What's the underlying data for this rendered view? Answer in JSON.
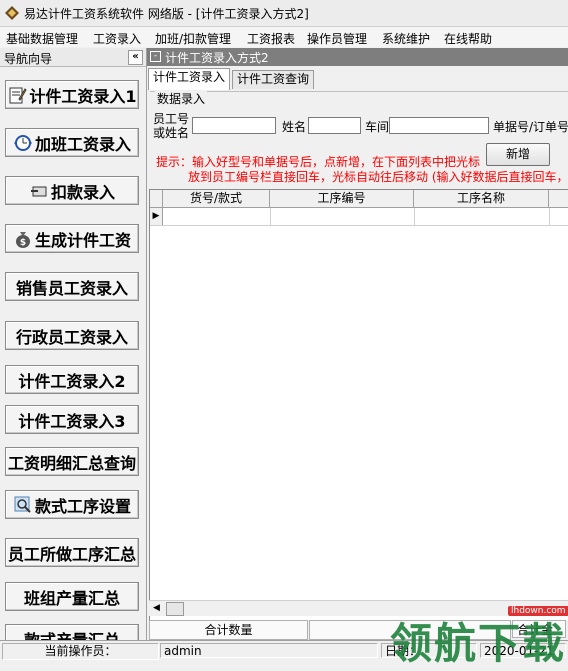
{
  "window": {
    "title": "易达计件工资系统软件  网络版  -  [计件工资录入方式2]"
  },
  "menu": [
    "基础数据管理",
    "工资录入",
    "加班/扣款管理",
    "工资报表",
    "操作员管理",
    "系统维护",
    "在线帮助"
  ],
  "nav": {
    "title": "导航向导",
    "collapse_label": "«",
    "items": [
      {
        "label": "计件工资录入1",
        "icon": "pencil-sheet-icon"
      },
      {
        "label": "加班工资录入",
        "icon": "clock-arrows-icon"
      },
      {
        "label": "扣款录入",
        "icon": "deduct-icon"
      },
      {
        "label": "生成计件工资",
        "icon": "money-bag-icon"
      },
      {
        "label": "销售员工资录入",
        "icon": ""
      },
      {
        "label": "行政员工资录入",
        "icon": ""
      },
      {
        "label": "计件工资录入2",
        "icon": ""
      },
      {
        "label": "计件工资录入3",
        "icon": ""
      },
      {
        "label": "工资明细汇总查询",
        "icon": ""
      },
      {
        "label": "款式工序设置",
        "icon": "search-magnifier-icon"
      },
      {
        "label": "员工所做工序汇总",
        "icon": ""
      },
      {
        "label": "班组产量汇总",
        "icon": ""
      },
      {
        "label": "款式产量汇总",
        "icon": ""
      }
    ]
  },
  "main": {
    "panel_title": "计件工资录入方式2",
    "close_glyph": "-",
    "tabs": [
      "计件工资录入",
      "计件工资查询"
    ],
    "group_title": "数据录入",
    "fields": {
      "emp_label_1": "员工号",
      "emp_label_2": "或姓名",
      "emp_value": "",
      "name_label": "姓名",
      "name_value": "",
      "workshop_label": "车间",
      "workshop_value": "",
      "order_label": "单据号/订单号",
      "order_value": ""
    },
    "add_button": "新增",
    "hint_line1": "提示：输入好型号和单据号后，点新增，在下面列表中把光标",
    "hint_line2": "放到员工编号栏直接回车，光标自动往后移动 (输入好数据后直接回车，光",
    "columns": [
      "货号/款式",
      "工序编号",
      "工序名称"
    ],
    "row_indicator": "▶",
    "footer_total_label": "合计数量",
    "footer_total_label_2": "合计金"
  },
  "status": {
    "operator_label": "当前操作员：",
    "operator_value": "admin",
    "date_label": "日期：",
    "date_value": "2020-01-21"
  },
  "watermark": {
    "text": "领航下载",
    "site": "lhdown.com"
  },
  "colors": {
    "hint": "#ff0000",
    "panel_header": "#7e7e7e"
  }
}
